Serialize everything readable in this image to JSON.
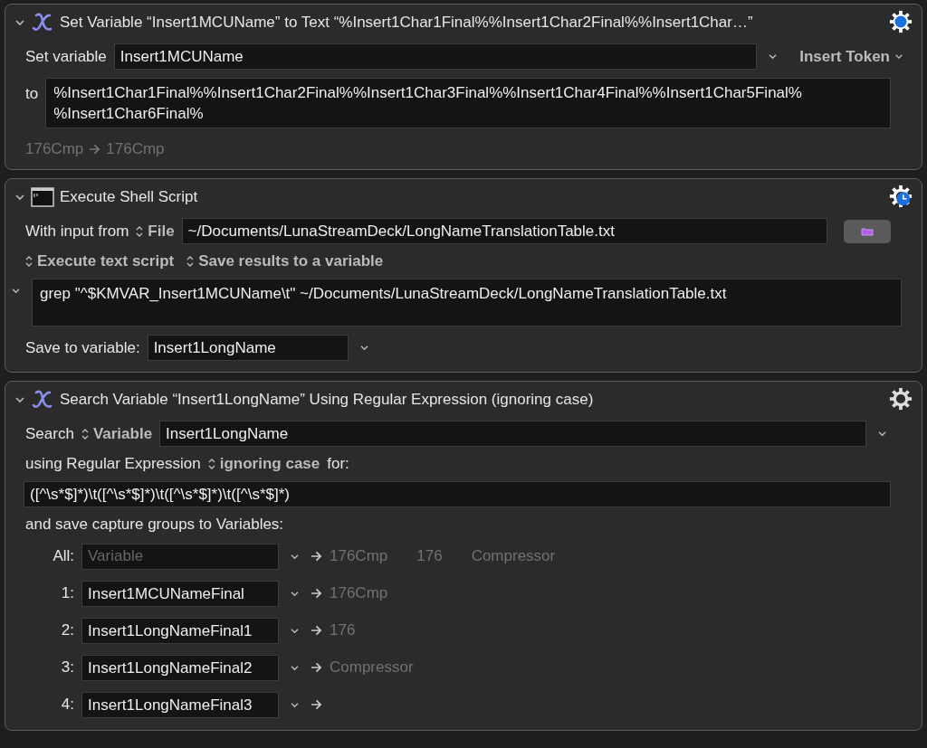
{
  "actions": [
    {
      "kind": "set_variable",
      "expanded": true,
      "gear_highlighted": true,
      "timed": false,
      "title": "Set Variable “Insert1MCUName” to Text “%Insert1Char1Final%%Insert1Char2Final%%Insert1Char…”",
      "set_label": "Set variable",
      "variable": "Insert1MCUName",
      "insert_token": "Insert Token",
      "to_label": "to",
      "text": "%Insert1Char1Final%%Insert1Char2Final%%Insert1Char3Final%%Insert1Char4Final%%Insert1Char5Final%\n%Insert1Char6Final%",
      "preview_from": "176Cmp",
      "preview_to": "176Cmp"
    },
    {
      "kind": "shell_script",
      "expanded": true,
      "gear_highlighted": false,
      "timed": true,
      "title": "Execute Shell Script",
      "input_label": "With input from",
      "input_source": "File",
      "file_path": "~/Documents/LunaStreamDeck/LongNameTranslationTable.txt",
      "execute_option": "Execute text script",
      "results_option": "Save results to a variable",
      "script_expanded": true,
      "script": "grep \"^$KMVAR_Insert1MCUName\\t\" ~/Documents/LunaStreamDeck/LongNameTranslationTable.txt",
      "save_label": "Save to variable:",
      "save_variable": "Insert1LongName"
    },
    {
      "kind": "search_regex",
      "expanded": true,
      "gear_highlighted": false,
      "timed": false,
      "title": "Search Variable “Insert1LongName” Using Regular Expression (ignoring case)",
      "search_label": "Search",
      "source": "Variable",
      "variable": "Insert1LongName",
      "using_label": "using Regular Expression",
      "case_option": "ignoring case",
      "for_label": "for:",
      "pattern": "([^\\s*$]*)\\t([^\\s*$]*)\\t([^\\s*$]*)\\t([^\\s*$]*)",
      "capture_label": "and save capture groups to Variables:",
      "captures": [
        {
          "label": "All:",
          "placeholder": "Variable",
          "results": [
            "176Cmp",
            "176",
            "Compressor"
          ]
        },
        {
          "label": "1:",
          "variable": "Insert1MCUNameFinal",
          "results": [
            "176Cmp"
          ]
        },
        {
          "label": "2:",
          "variable": "Insert1LongNameFinal1",
          "results": [
            "176"
          ]
        },
        {
          "label": "3:",
          "variable": "Insert1LongNameFinal2",
          "results": [
            "Compressor"
          ]
        },
        {
          "label": "4:",
          "variable": "Insert1LongNameFinal3"
        }
      ]
    }
  ]
}
